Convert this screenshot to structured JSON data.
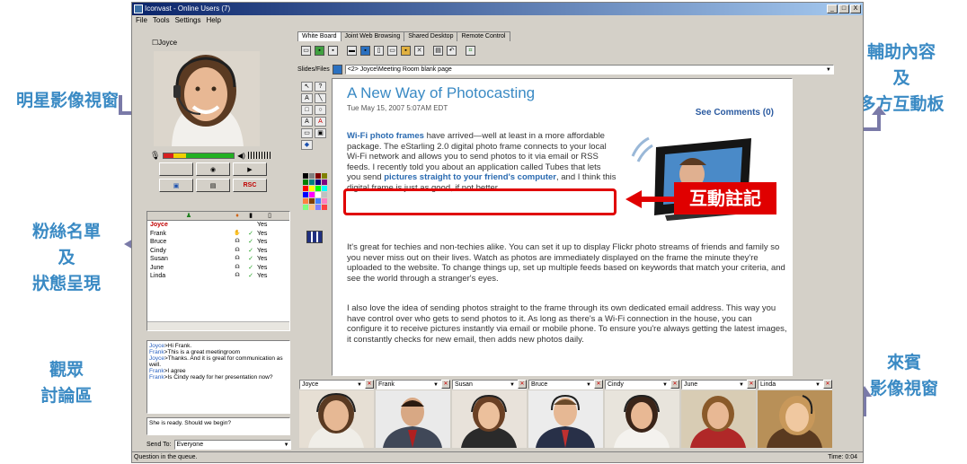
{
  "window": {
    "title": "Iconvast - Online Users (7)",
    "menu": [
      "File",
      "Tools",
      "Settings",
      "Help"
    ],
    "controls": [
      "_",
      "□",
      "X"
    ]
  },
  "callouts": {
    "star_video": "明星影像視窗",
    "aux_content": [
      "輔助內容",
      "及",
      "多方互動板"
    ],
    "fan_list": [
      "粉絲名單",
      "及",
      "狀態呈現"
    ],
    "discussion": [
      "觀眾",
      "討論區"
    ],
    "guest_video": [
      "來賓",
      "影像視窗"
    ],
    "annotation": "互動註記"
  },
  "star": {
    "name": "Joyce"
  },
  "control_buttons": [
    "",
    "",
    "",
    "",
    "",
    "RSC"
  ],
  "fans": {
    "headers": [
      "",
      "",
      "",
      ""
    ],
    "rows": [
      {
        "name": "Joyce",
        "status": "",
        "check": "",
        "yes": "Yes",
        "me": true
      },
      {
        "name": "Frank",
        "status": "",
        "check": "✓",
        "yes": "Yes"
      },
      {
        "name": "Bruce",
        "status": "",
        "check": "✓",
        "yes": "Yes"
      },
      {
        "name": "Cindy",
        "status": "",
        "check": "✓",
        "yes": "Yes"
      },
      {
        "name": "Susan",
        "status": "",
        "check": "✓",
        "yes": "Yes"
      },
      {
        "name": "June",
        "status": "",
        "check": "✓",
        "yes": "Yes"
      },
      {
        "name": "Linda",
        "status": "",
        "check": "✓",
        "yes": "Yes"
      }
    ]
  },
  "chat": {
    "messages": [
      {
        "who": "Joyce",
        "text": ">Hi Frank."
      },
      {
        "who": "Frank",
        "text": ">This is a great meetingroom"
      },
      {
        "who": "Joyce",
        "text": ">Thanks. And it is great for communication as well."
      },
      {
        "who": "Frank",
        "text": ">I agree"
      },
      {
        "who": "Frank",
        "text": ">Is Cindy ready for her presentation now?"
      }
    ],
    "input": "She is ready. Should we begin?",
    "send_to_label": "Send To:",
    "send_to_value": "Everyone"
  },
  "status": {
    "text": "Question in the queue.",
    "time": "Time: 0:04"
  },
  "tabs": [
    "White Board",
    "Joint Web Browsing",
    "Shared Desktop",
    "Remote Control"
  ],
  "slides": {
    "label": "Slides/Files",
    "value": "<2> Joyce\\Meeting Room blank page"
  },
  "article": {
    "title": "A New Way of Photocasting",
    "date": "Tue May 15, 2007 5:07AM EDT",
    "comments": "See Comments (0)",
    "p1_link": "Wi-Fi photo frames",
    "p1": " have arrived—well at least in a more affordable package. The eStarling 2.0 digital photo frame connects to your local Wi-Fi network and allows you to send photos to it via email or RSS feeds. I recently told you about an application called Tubes that lets you send",
    "p1_link2": "pictures straight to your friend's computer",
    "p1_end": ", and I think this digital frame is just as good, if not better.",
    "p2": "It's great for techies and non-techies alike. You can set it up to display Flickr photo streams of friends and family so you never miss out on their lives. Watch as photos are immediately displayed on the frame the minute they're uploaded to the website. To change things up, set up multiple feeds based on keywords that match your criteria, and see the world through a stranger's eyes.",
    "p3": "I also love the idea of sending photos straight to the frame through its own dedicated email address. This way you have control over who gets to send photos to it. As long as there's a Wi-Fi connection in the house, you can configure it to receive pictures instantly via email or mobile phone. To ensure you're always getting the latest images, it constantly checks for new email, then adds new photos daily."
  },
  "guests": [
    "Joyce",
    "Frank",
    "Susan",
    "Bruce",
    "Cindy",
    "June",
    "Linda"
  ],
  "colors": {
    "callout": "#3a8ac4",
    "annotation_red": "#e00000",
    "title_bar": "#0a246a"
  }
}
